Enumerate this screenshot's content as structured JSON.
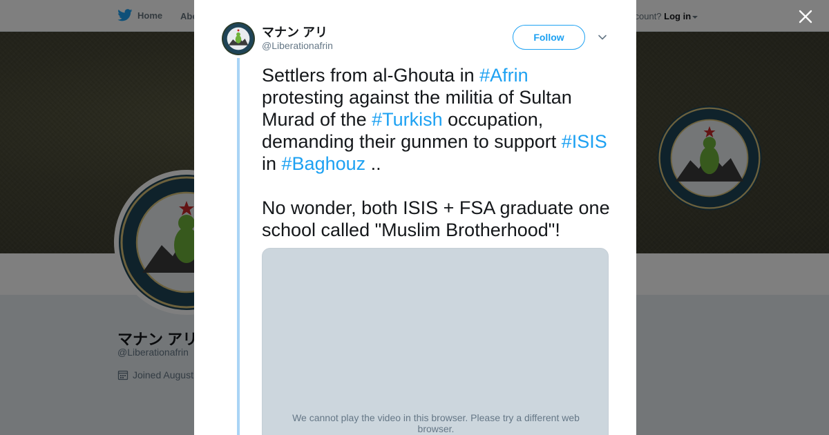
{
  "nav": {
    "home_label": "Home",
    "about_label": "Abo",
    "account_prompt": "ccount?",
    "login_label": "Log in"
  },
  "profile": {
    "name": "マナン アリ",
    "handle": "@Liberationafrin",
    "joined": "Joined August"
  },
  "tweet": {
    "author_name": "マナン アリ",
    "author_handle": "@Liberationafrin",
    "follow_label": "Follow",
    "text": {
      "t1": "Settlers from al-Ghouta in ",
      "h1": "#Afrin",
      "t2": " protesting against the militia of Sultan Murad of the ",
      "h2": "#Turkish",
      "t3": " occupation, demanding their gunmen to support ",
      "h3": "#ISIS",
      "t4": " in ",
      "h4": "#Baghouz",
      "t5": " ..",
      "p2": "No wonder, both ISIS + FSA graduate one school called \"Muslim Brotherhood\"!"
    },
    "media_message": "We cannot play the video in this browser. Please try a different web browser."
  },
  "icons": {
    "twitter_bird": "bird-icon",
    "calendar": "calendar-icon",
    "close": "close-icon",
    "chevron": "chevron-down-icon"
  },
  "colors": {
    "accent": "#1da1f2",
    "thread_line": "#a9d4f5",
    "media_bg": "#ccd6dd",
    "overlay": "rgba(0,0,0,0.5)"
  }
}
